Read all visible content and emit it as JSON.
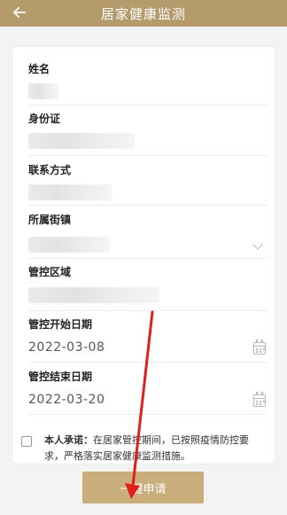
{
  "header": {
    "title": "居家健康监测",
    "back_icon": "arrow-left-icon",
    "background": "#b59a6b"
  },
  "form": {
    "name_label": "姓名",
    "id_label": "身份证",
    "contact_label": "联系方式",
    "street_label": "所属街镇",
    "area_label": "管控区域",
    "start_date_label": "管控开始日期",
    "start_date_value": "2022-03-08",
    "end_date_label": "管控结束日期",
    "end_date_value": "2022-03-20"
  },
  "agreement": {
    "bold": "本人承诺：",
    "text": "在居家管控期间，已按照疫情防控要求，严格落实居家健康监测措施。"
  },
  "submit": {
    "label": "一键申请",
    "color": "#c9ae7c"
  },
  "annotation": {
    "arrow_color": "#e0201a"
  }
}
